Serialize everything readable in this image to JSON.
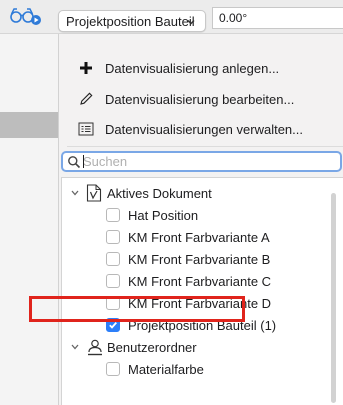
{
  "toolbar": {
    "visualization_button_icon": "glasses-play-icon",
    "dropdown_value": "Projektposition Bauteil",
    "angle_value": "0.00°"
  },
  "menu": {
    "items": [
      {
        "label": "Datenvisualisierung anlegen...",
        "icon": "plus-icon"
      },
      {
        "label": "Datenvisualisierung bearbeiten...",
        "icon": "pencil-icon"
      },
      {
        "label": "Datenvisualisierungen verwalten...",
        "icon": "list-manage-icon"
      }
    ],
    "search": {
      "placeholder": "Suchen",
      "value": ""
    }
  },
  "tree": {
    "groups": [
      {
        "label": "Aktives Dokument",
        "icon": "document-icon",
        "expanded": true,
        "items": [
          {
            "label": "Hat Position",
            "checked": false
          },
          {
            "label": "KM Front Farbvariante A",
            "checked": false
          },
          {
            "label": "KM Front Farbvariante B",
            "checked": false
          },
          {
            "label": "KM Front Farbvariante C",
            "checked": false
          },
          {
            "label": "KM Front Farbvariante D",
            "checked": false
          },
          {
            "label": "Projektposition Bauteil (1)",
            "checked": true
          }
        ]
      },
      {
        "label": "Benutzerordner",
        "icon": "user-folder-icon",
        "expanded": true,
        "items": [
          {
            "label": "Materialfarbe",
            "checked": false
          }
        ]
      }
    ]
  },
  "colors": {
    "accent": "#2d7ff9",
    "highlight_border": "#e0241c",
    "search_focus": "#7aa7e6"
  }
}
